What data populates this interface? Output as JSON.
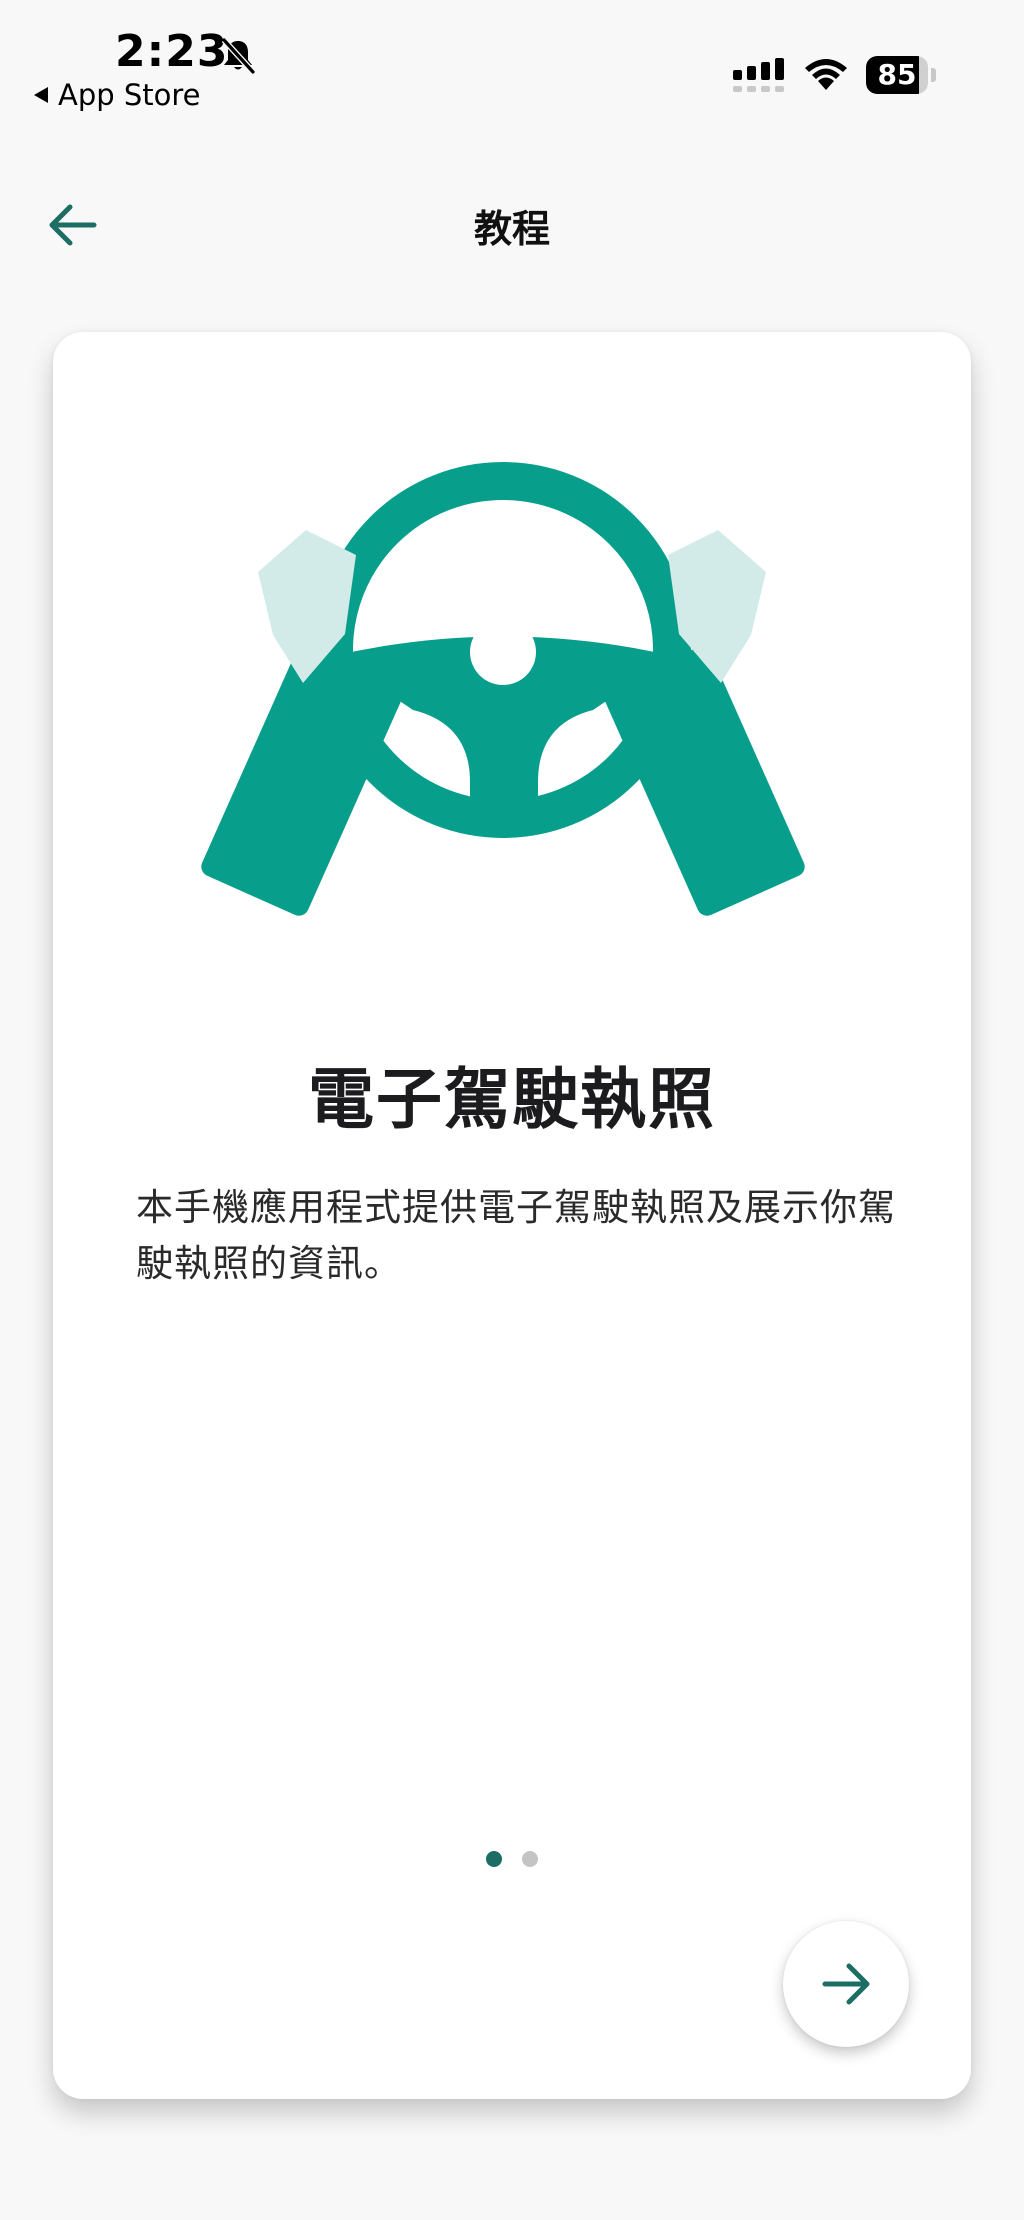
{
  "status_bar": {
    "time": "2:23",
    "back_app": "App Store",
    "battery": "85",
    "battery_level": 0.85
  },
  "header": {
    "title": "教程",
    "back_icon": "arrow-left-icon"
  },
  "card": {
    "title": "電子駕駛執照",
    "description": "本手機應用程式提供電子駕駛執照及展示你駕駛執照的資訊。",
    "illustration_icon": "steering-wheel-hands-icon"
  },
  "pager": {
    "pages": 2,
    "current": 1
  },
  "next_button": {
    "icon": "arrow-right-icon"
  },
  "colors": {
    "accent": "#1c6e64",
    "illustration_primary": "#079e8c",
    "illustration_light": "#d3ebe8",
    "background": "#f8f8f8",
    "card": "#ffffff"
  }
}
